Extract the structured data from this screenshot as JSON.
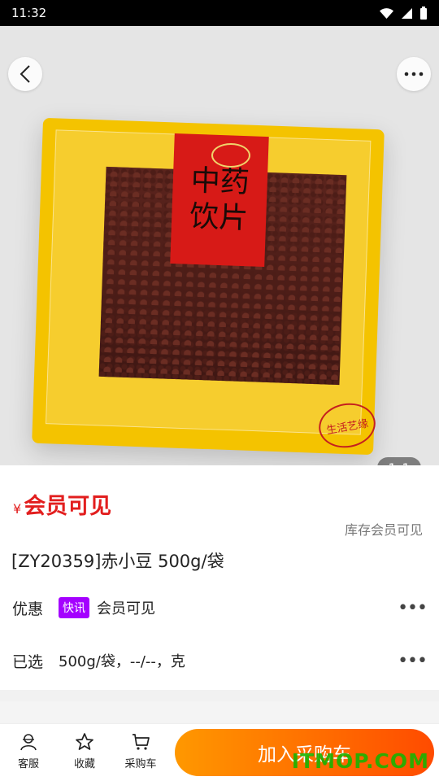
{
  "status": {
    "time": "11:32"
  },
  "hero": {
    "package_text_1": "中药",
    "package_text_2": "饮片",
    "seal_text": "生活艺缘",
    "image_counter_current": "1",
    "image_counter_total": "1"
  },
  "product": {
    "price_symbol": "¥",
    "price_text": "会员可见",
    "stock_text": "库存会员可见",
    "title": "[ZY20359]赤小豆 500g/袋"
  },
  "discount": {
    "label": "优惠",
    "tag": "快讯",
    "value": "会员可见"
  },
  "selected": {
    "label": "已选",
    "value": "500g/袋，--/--，克"
  },
  "bottom_bar": {
    "service_label": "客服",
    "favorite_label": "收藏",
    "cart_label": "采购车",
    "add_button": "加入采购车"
  },
  "watermark": {
    "text": "ITMOP.COM"
  },
  "colors": {
    "price": "#e21e1e",
    "tag": "#a400ff",
    "button_start": "#ff9800",
    "button_end": "#ff4b00"
  },
  "icons": [
    "back-arrow-icon",
    "more-dots-icon",
    "service-person-icon",
    "star-icon",
    "cart-icon",
    "wifi-icon",
    "signal-icon",
    "battery-icon"
  ]
}
